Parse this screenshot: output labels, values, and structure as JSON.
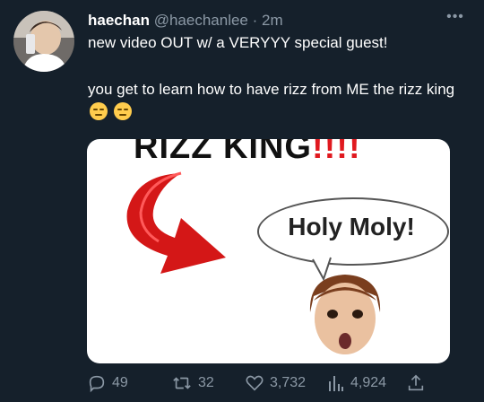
{
  "tweet": {
    "author_name": "haechan",
    "handle": "@haechanlee",
    "separator": "·",
    "time": "2m",
    "line1": "new video OUT w/ a VERYYY special guest!",
    "line2": "you get to learn how to have rizz from ME the rizz king",
    "media": {
      "title_text": "RIZZ KING",
      "title_bangs": "!!!!",
      "bubble_text": "Holy Moly!"
    }
  },
  "actions": {
    "replies": "49",
    "retweets": "32",
    "likes": "3,732",
    "views": "4,924"
  },
  "colors": {
    "background": "#15202b",
    "secondary_text": "#8b98a5",
    "arrow_red": "#d41717"
  }
}
